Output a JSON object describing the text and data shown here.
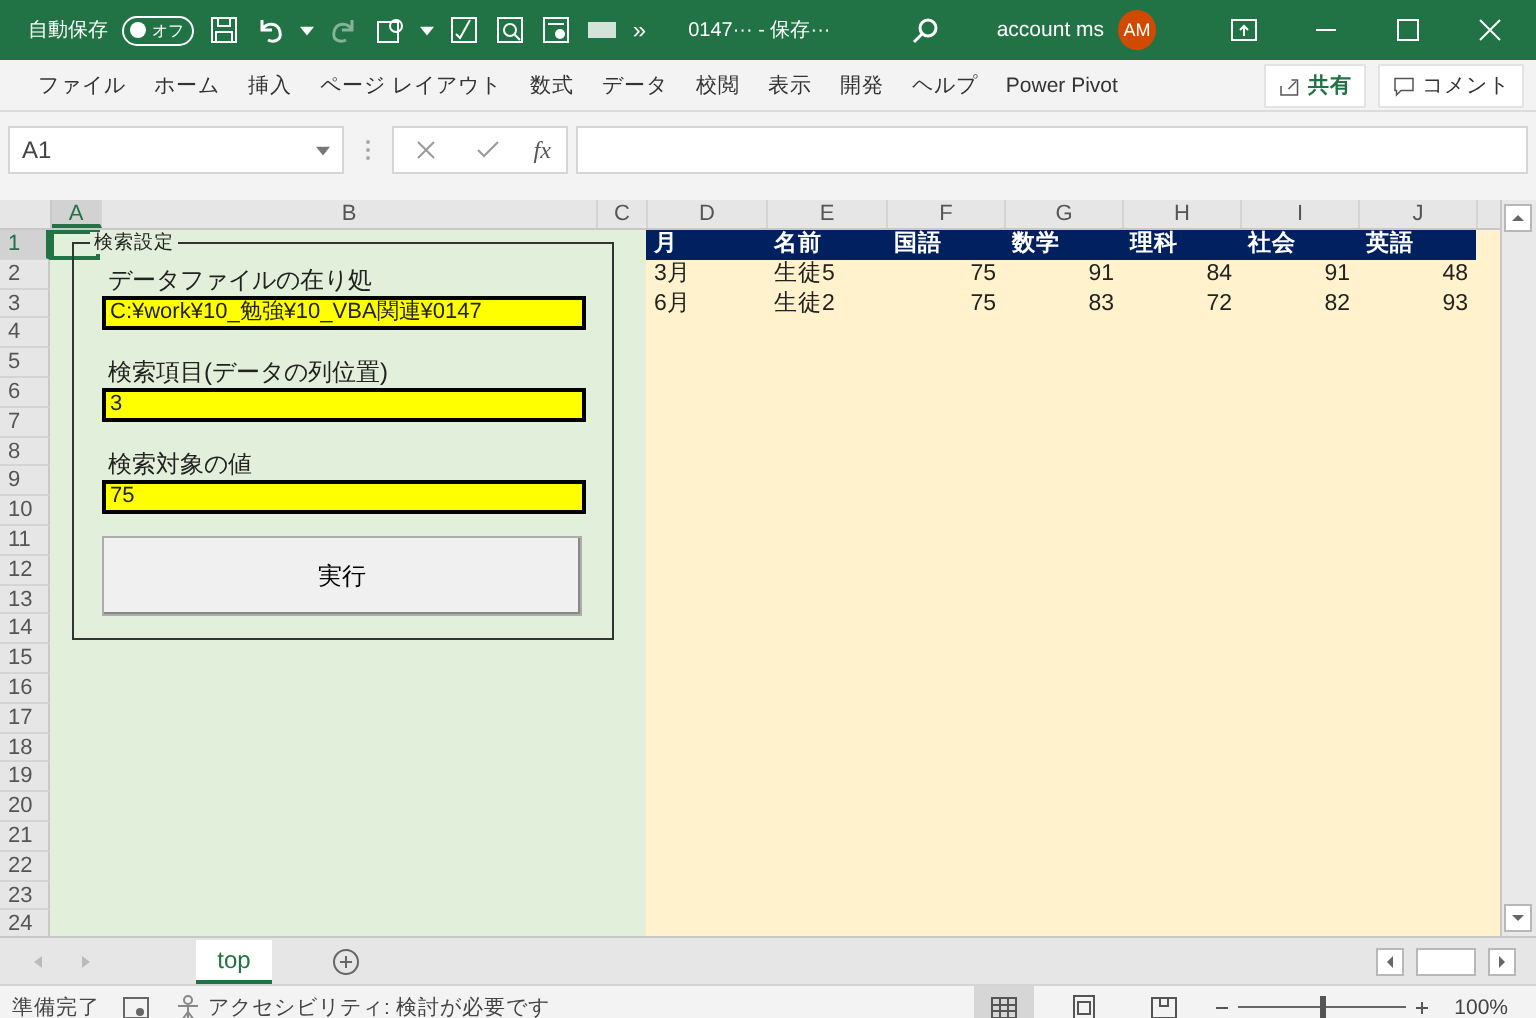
{
  "titlebar": {
    "autosave_label": "自動保存",
    "autosave": {
      "on": false,
      "label": "オフ"
    },
    "overflow": "»",
    "title": "0147··· - 保存···",
    "account": "account ms",
    "avatar": "AM"
  },
  "ribbon_tabs": [
    "ファイル",
    "ホーム",
    "挿入",
    "ページ レイアウト",
    "数式",
    "データ",
    "校閲",
    "表示",
    "開発",
    "ヘルプ",
    "Power Pivot"
  ],
  "share_button": "共有",
  "comment_button": "コメント",
  "name_box": "A1",
  "fx": "fx",
  "columns": [
    {
      "label": "A",
      "selected": true
    },
    {
      "label": "B",
      "selected": false
    },
    {
      "label": "C",
      "selected": false
    },
    {
      "label": "D",
      "selected": false
    },
    {
      "label": "E",
      "selected": false
    },
    {
      "label": "F",
      "selected": false
    },
    {
      "label": "G",
      "selected": false
    },
    {
      "label": "H",
      "selected": false
    },
    {
      "label": "I",
      "selected": false
    },
    {
      "label": "J",
      "selected": false
    }
  ],
  "rows": [
    {
      "label": "1",
      "selected": true
    },
    {
      "label": "2",
      "selected": false
    },
    {
      "label": "3",
      "selected": false
    },
    {
      "label": "4",
      "selected": false
    },
    {
      "label": "5",
      "selected": false
    },
    {
      "label": "6",
      "selected": false
    },
    {
      "label": "7",
      "selected": false
    },
    {
      "label": "8",
      "selected": false
    },
    {
      "label": "9",
      "selected": false
    },
    {
      "label": "10",
      "selected": false
    },
    {
      "label": "11",
      "selected": false
    },
    {
      "label": "12",
      "selected": false
    },
    {
      "label": "13",
      "selected": false
    },
    {
      "label": "14",
      "selected": false
    },
    {
      "label": "15",
      "selected": false
    },
    {
      "label": "16",
      "selected": false
    },
    {
      "label": "17",
      "selected": false
    },
    {
      "label": "18",
      "selected": false
    },
    {
      "label": "19",
      "selected": false
    },
    {
      "label": "20",
      "selected": false
    },
    {
      "label": "21",
      "selected": false
    },
    {
      "label": "22",
      "selected": false
    },
    {
      "label": "23",
      "selected": false
    },
    {
      "label": "24",
      "selected": false
    }
  ],
  "form": {
    "title": "検索設定",
    "fields": [
      {
        "label": "データファイルの在り処",
        "value": "C:¥work¥10_勉強¥10_VBA関連¥0147"
      },
      {
        "label": "検索項目(データの列位置)",
        "value": "3"
      },
      {
        "label": "検索対象の値",
        "value": "75"
      }
    ],
    "button": "実行"
  },
  "table": {
    "header": [
      "月",
      "名前",
      "国語",
      "数学",
      "理科",
      "社会",
      "英語"
    ],
    "rows": [
      [
        "3月",
        "生徒5",
        "75",
        "91",
        "84",
        "91",
        "48"
      ],
      [
        "6月",
        "生徒2",
        "75",
        "83",
        "72",
        "82",
        "93"
      ]
    ]
  },
  "sheet_tabs": [
    {
      "label": "top",
      "selected": true
    }
  ],
  "status": {
    "ready": "準備完了",
    "accessibility": "アクセシビリティ: 検討が必要です",
    "views": [
      {
        "kind": "normal",
        "selected": true
      },
      {
        "kind": "page_layout",
        "selected": false
      },
      {
        "kind": "page_break",
        "selected": false
      }
    ],
    "zoom": {
      "label": "100%",
      "level": 0.5
    }
  }
}
